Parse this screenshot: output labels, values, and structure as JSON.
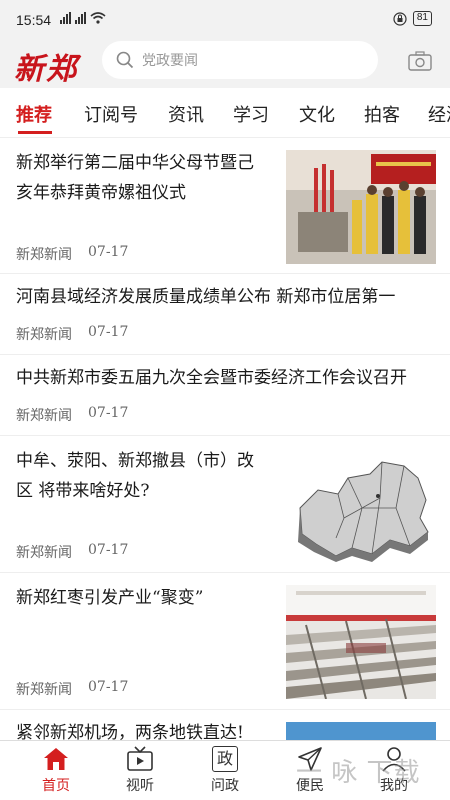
{
  "status": {
    "time": "15:54",
    "battery": "81"
  },
  "header": {
    "logo": "新郑",
    "search_placeholder": "党政要闻"
  },
  "tabs": [
    {
      "label": "推荐",
      "active": true
    },
    {
      "label": "订阅号"
    },
    {
      "label": "资讯"
    },
    {
      "label": "学习"
    },
    {
      "label": "文化"
    },
    {
      "label": "拍客"
    },
    {
      "label": "经济"
    }
  ],
  "news": [
    {
      "title": "新郑举行第二届中华父母节暨己亥年恭拜黄帝嫘祖仪式",
      "source": "新郑新闻",
      "date": "07-17",
      "thumb": "ceremony"
    },
    {
      "title": "河南县域经济发展质量成绩单公布 新郑市位居第一",
      "source": "新郑新闻",
      "date": "07-17"
    },
    {
      "title": "中共新郑市委五届九次全会暨市委经济工作会议召开",
      "source": "新郑新闻",
      "date": "07-17"
    },
    {
      "title": "中牟、荥阳、新郑撤县（市）改区 将带来啥好处?",
      "source": "新郑新闻",
      "date": "07-17",
      "thumb": "map"
    },
    {
      "title": "新郑红枣引发产业“聚变”",
      "source": "新郑新闻",
      "date": "07-17",
      "thumb": "factory"
    },
    {
      "title": "紧邻新郑机场，两条地铁直达!",
      "thumb": "sky"
    }
  ],
  "bottom_nav": [
    {
      "label": "首页",
      "icon": "home-icon",
      "active": true
    },
    {
      "label": "视听",
      "icon": "tv-icon"
    },
    {
      "label": "问政",
      "icon": "politics-icon",
      "glyph": "政"
    },
    {
      "label": "便民",
      "icon": "send-icon"
    },
    {
      "label": "我的",
      "icon": "user-icon"
    }
  ],
  "watermark": "一 咏 下载",
  "colors": {
    "accent": "#d41f1f",
    "logo": "#c8141c"
  }
}
